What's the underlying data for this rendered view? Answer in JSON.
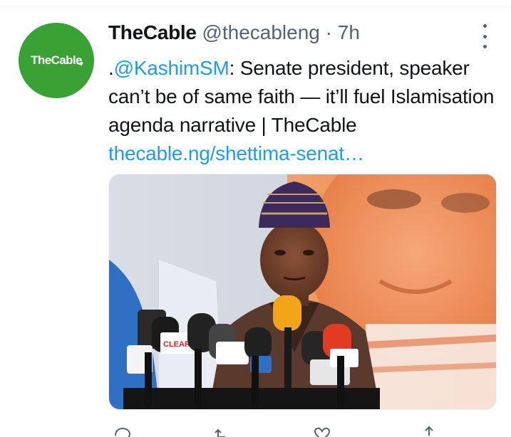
{
  "tweet": {
    "display_name": "TheCable",
    "handle": "@thecableng",
    "separator": "·",
    "time": "7h",
    "avatar_text": "TheCable",
    "text_prefix": ".",
    "mention": "@KashimSM",
    "text_body": ": Senate president, speaker can’t be of same faith — it’ll fuel Islamisation agenda narrative | TheCable ",
    "link": "thecable.ng/shettima-senat…"
  },
  "actions": [
    {
      "icon": "reply-icon"
    },
    {
      "icon": "retweet-icon"
    },
    {
      "icon": "like-icon"
    },
    {
      "icon": "share-icon"
    }
  ],
  "colors": {
    "brand_green": "#3aa235",
    "link_blue": "#1d9bf0",
    "secondary_text": "#536471"
  }
}
